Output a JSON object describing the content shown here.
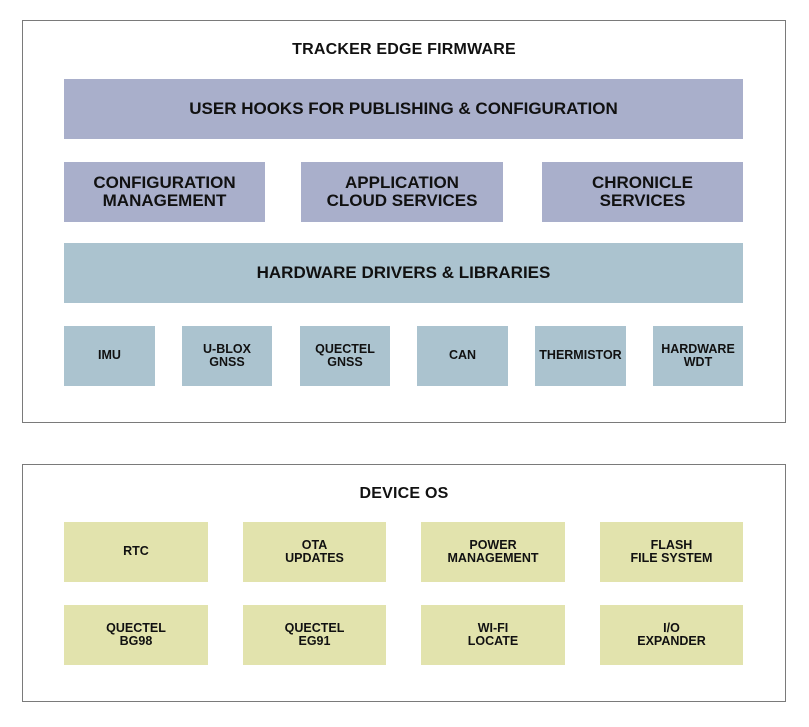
{
  "colors": {
    "purple": "#a9afcb",
    "blue": "#abc3cf",
    "yellow": "#e2e3ad",
    "border": "#7a7a7a"
  },
  "tracker": {
    "title": "TRACKER EDGE FIRMWARE",
    "user_hooks": "USER HOOKS FOR PUBLISHING & CONFIGURATION",
    "services": [
      "CONFIGURATION\nMANAGEMENT",
      "APPLICATION\nCLOUD SERVICES",
      "CHRONICLE\nSERVICES"
    ],
    "drivers": "HARDWARE DRIVERS & LIBRARIES",
    "modules": [
      "IMU",
      "U-BLOX\nGNSS",
      "QUECTEL\nGNSS",
      "CAN",
      "THERMISTOR",
      "HARDWARE\nWDT"
    ]
  },
  "device_os": {
    "title": "DEVICE OS",
    "row1": [
      "RTC",
      "OTA\nUPDATES",
      "POWER\nMANAGEMENT",
      "FLASH\nFILE SYSTEM"
    ],
    "row2": [
      "QUECTEL\nBG98",
      "QUECTEL\nEG91",
      "WI-FI\nLOCATE",
      "I/O\nEXPANDER"
    ]
  }
}
